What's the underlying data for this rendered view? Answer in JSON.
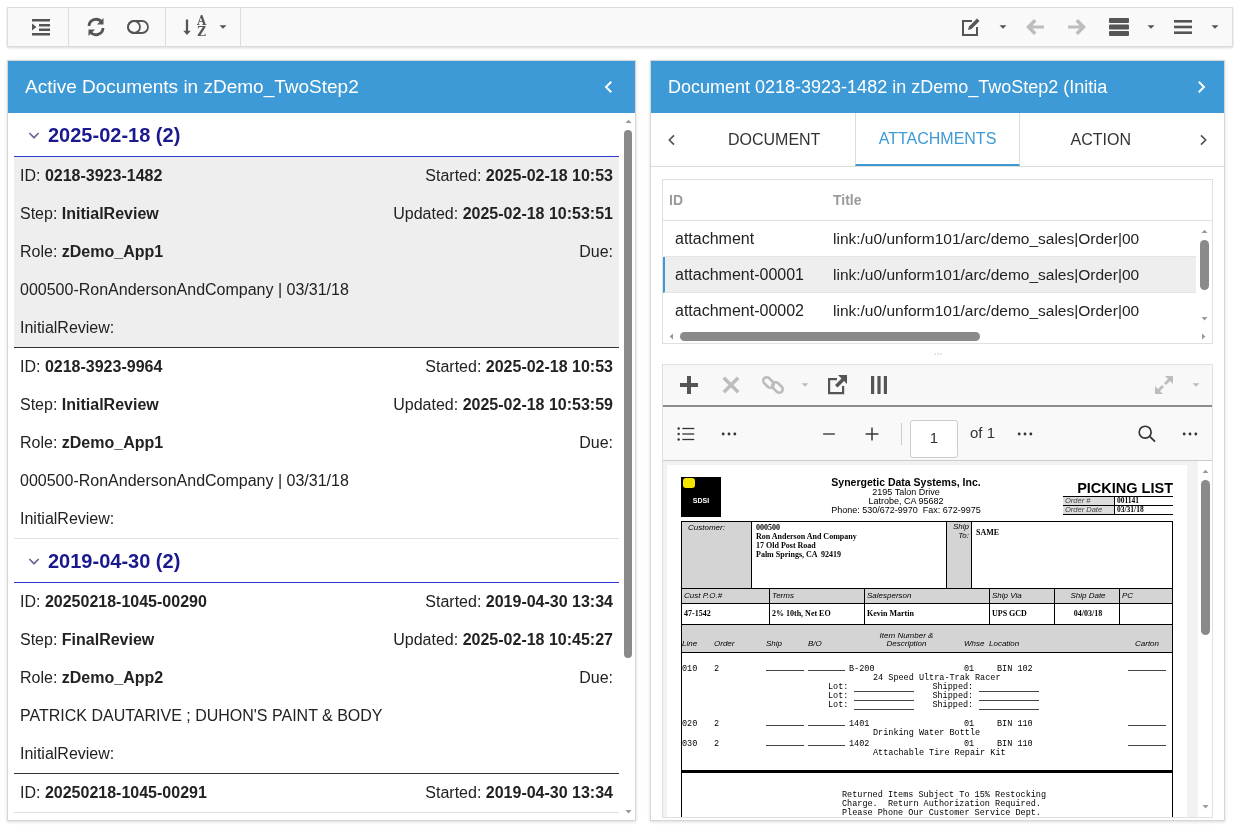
{
  "toolbar": {
    "left_groups": [
      [
        {
          "kind": "indent",
          "disabled": false
        }
      ],
      [
        {
          "kind": "refresh",
          "disabled": false
        },
        {
          "kind": "toggle",
          "disabled": false
        }
      ],
      [
        {
          "kind": "sort",
          "letters": [
            "A",
            "Z"
          ],
          "disabled": false
        },
        {
          "kind": "caret",
          "disabled": false
        }
      ]
    ],
    "right": [
      {
        "kind": "edit",
        "disabled": false
      },
      {
        "kind": "caret",
        "disabled": false
      },
      {
        "kind": "back",
        "disabled": true
      },
      {
        "kind": "forward",
        "disabled": true
      },
      {
        "kind": "rows",
        "disabled": false
      },
      {
        "kind": "caret",
        "disabled": false
      },
      {
        "kind": "menu",
        "disabled": false
      },
      {
        "kind": "caret",
        "disabled": false
      }
    ]
  },
  "documents_panel": {
    "title": "Active Documents in zDemo_TwoStep2",
    "groups": [
      {
        "date": "2025-02-18 (2)",
        "expanded": true,
        "documents": [
          {
            "selected": true,
            "rows": [
              {
                "left": "ID: **0218-3923-1482**",
                "right": "Started: **2025-02-18 10:53**"
              },
              {
                "left": "Step: **InitialReview**",
                "right": "Updated: **2025-02-18 10:53:51**"
              },
              {
                "left": "Role: **zDemo_App1**",
                "right": "Due:"
              },
              {
                "left": "000500-RonAndersonAndCompany | 03/31/18"
              },
              {
                "left": "InitialReview:"
              }
            ]
          },
          {
            "selected": false,
            "rows": [
              {
                "left": "ID: **0218-3923-9964**",
                "right": "Started: **2025-02-18 10:53**"
              },
              {
                "left": "Step: **InitialReview**",
                "right": "Updated: **2025-02-18 10:53:59**"
              },
              {
                "left": "Role: **zDemo_App1**",
                "right": "Due:"
              },
              {
                "left": "000500-RonAndersonAndCompany | 03/31/18"
              },
              {
                "left": "InitialReview:"
              }
            ]
          }
        ]
      },
      {
        "date": "2019-04-30 (2)",
        "expanded": true,
        "documents": [
          {
            "selected": false,
            "rows": [
              {
                "left": "ID: **20250218-1045-00290**",
                "right": "Started: **2019-04-30 13:34**"
              },
              {
                "left": "Step: **FinalReview**",
                "right": "Updated: **2025-02-18 10:45:27**"
              },
              {
                "left": "Role: **zDemo_App2**",
                "right": "Due:"
              },
              {
                "left": "PATRICK DAUTARIVE ; DUHON'S PAINT & BODY"
              },
              {
                "left": "InitialReview:"
              }
            ]
          },
          {
            "selected": false,
            "rows": [
              {
                "left": "ID: **20250218-1045-00291**",
                "right": "Started: **2019-04-30 13:34**"
              }
            ]
          }
        ]
      }
    ]
  },
  "document_panel": {
    "title": "Document 0218-3923-1482 in zDemo_TwoStep2 (Initia",
    "tabs": [
      {
        "label": "DOCUMENT",
        "selected": false
      },
      {
        "label": "ATTACHMENTS",
        "selected": true
      },
      {
        "label": "ACTION",
        "selected": false
      }
    ],
    "attachments": {
      "columns": [
        "ID",
        "Title"
      ],
      "rows": [
        {
          "id": "attachment",
          "title": "link:/u0/unform101/arc/demo_sales|Order|00",
          "selected": false
        },
        {
          "id": "attachment-00001",
          "title": "link:/u0/unform101/arc/demo_sales|Order|00",
          "selected": true
        },
        {
          "id": "attachment-00002",
          "title": "link:/u0/unform101/arc/demo_sales|Order|00",
          "selected": false
        }
      ]
    },
    "viewer_toolbar": {
      "left": [
        {
          "kind": "plus",
          "disabled": false
        },
        {
          "kind": "delete",
          "disabled": true
        },
        {
          "kind": "link",
          "disabled": true
        },
        {
          "kind": "caret",
          "disabled": true
        },
        {
          "kind": "external",
          "disabled": false
        },
        {
          "kind": "columns",
          "disabled": false
        }
      ],
      "right": [
        {
          "kind": "expand",
          "disabled": true
        },
        {
          "kind": "caret",
          "disabled": true
        }
      ]
    },
    "pdf_toolbar": {
      "page": "1",
      "page_count": "of 1"
    },
    "pdf": {
      "logo": "SDSI",
      "company": "Synergetic Data Systems, Inc.",
      "address": [
        "2195 Talon Drive",
        "Latrobe, CA 95682",
        "Phone: 530/672-9970  Fax: 672-9975"
      ],
      "title": "PICKING LIST",
      "order_fields": [
        {
          "label": "Order #",
          "value": "001141"
        },
        {
          "label": "Order Date",
          "value": "03/31/18"
        }
      ],
      "customer_label": "Customer:",
      "customer": [
        "000500",
        "Ron Anderson And Company",
        "17 Old Post Road",
        "Palm Springs, CA  92419"
      ],
      "ship_to_label": "Ship To:",
      "ship_to": "SAME",
      "info": [
        {
          "header": "Cust P.O.#",
          "value": "47-1542"
        },
        {
          "header": "Terms",
          "value": "2% 10th, Net EO"
        },
        {
          "header": "Salesperson",
          "value": "Kevin Martin"
        },
        {
          "header": "Ship Via",
          "value": "UPS GCD"
        },
        {
          "header": "Ship Date",
          "value": "04/03/18"
        },
        {
          "header": "PC"
        }
      ],
      "item_columns": [
        "Line",
        "Order",
        "Ship",
        "B/O",
        "Item Number & Description",
        "Whse",
        "Location",
        "Carton"
      ],
      "items": [
        {
          "line": "010",
          "order": "2",
          "item_number": "B-200",
          "whse": "01",
          "location": "BIN 102",
          "description": "24 Speed Ultra-Trak Racer",
          "lots": [
            {
              "lot": "Lot:",
              "shipped": "Shipped:"
            },
            {
              "lot": "Lot:",
              "shipped": "Shipped:"
            },
            {
              "lot": "Lot:",
              "shipped": "Shipped:"
            }
          ]
        },
        {
          "line": "020",
          "order": "2",
          "item_number": "1401",
          "whse": "01",
          "location": "BIN 110",
          "description": "Drinking Water Bottle"
        },
        {
          "line": "030",
          "order": "2",
          "item_number": "1402",
          "whse": "01",
          "location": "BIN 110",
          "description": "Attachable Tire Repair Kit"
        }
      ],
      "footer": [
        "Returned Items Subject To 15% Restocking",
        "Charge.  Return Authorization Required.",
        "Please Phone Our Customer Service Dept."
      ]
    }
  }
}
